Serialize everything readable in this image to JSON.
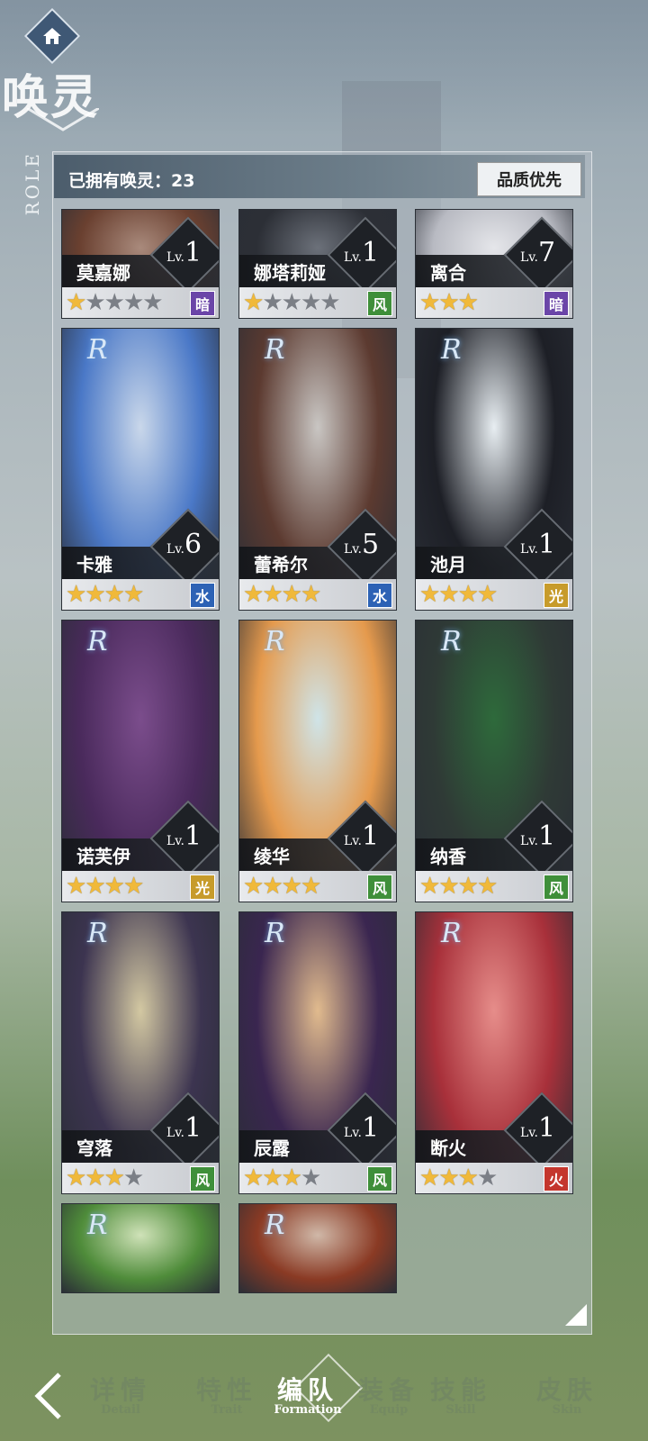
{
  "header": {
    "title": "唤灵",
    "role_label": "ROLE",
    "owned_text": "已拥有唤灵：23",
    "sort_label": "品质优先"
  },
  "cards": [
    {
      "name": "莫嘉娜",
      "level": "1",
      "stars": 1,
      "max_stars": 5,
      "element": "暗",
      "element_class": "e-dark",
      "colors": [
        "#6a4030",
        "#a98a7c"
      ]
    },
    {
      "name": "娜塔莉娅",
      "level": "1",
      "stars": 1,
      "max_stars": 5,
      "element": "风",
      "element_class": "e-wind",
      "colors": [
        "#2c2f36",
        "#6c717a"
      ]
    },
    {
      "name": "离合",
      "level": "7",
      "stars": 3,
      "max_stars": 3,
      "element": "暗",
      "element_class": "e-dark",
      "colors": [
        "#b8bac2",
        "#e5e6ea"
      ]
    },
    {
      "name": "卡雅",
      "level": "6",
      "rank": "R",
      "stars": 4,
      "max_stars": 4,
      "element": "水",
      "element_class": "e-water",
      "colors": [
        "#4a78c7",
        "#c9d7ea"
      ]
    },
    {
      "name": "蕾希尔",
      "level": "5",
      "rank": "R",
      "stars": 4,
      "max_stars": 4,
      "element": "水",
      "element_class": "e-water",
      "colors": [
        "#5c3a30",
        "#c9c6c3"
      ]
    },
    {
      "name": "池月",
      "level": "1",
      "rank": "R",
      "stars": 4,
      "max_stars": 4,
      "element": "光",
      "element_class": "e-light",
      "colors": [
        "#1d1f26",
        "#e8eef2"
      ]
    },
    {
      "name": "诺芙伊",
      "level": "1",
      "rank": "R",
      "stars": 4,
      "max_stars": 4,
      "element": "光",
      "element_class": "e-light",
      "colors": [
        "#4a2a5c",
        "#7b4d8c"
      ]
    },
    {
      "name": "绫华",
      "level": "1",
      "rank": "R",
      "stars": 4,
      "max_stars": 4,
      "element": "风",
      "element_class": "e-wind",
      "colors": [
        "#e59a4d",
        "#cfe4e8"
      ]
    },
    {
      "name": "纳香",
      "level": "1",
      "rank": "R",
      "stars": 4,
      "max_stars": 4,
      "element": "风",
      "element_class": "e-wind",
      "colors": [
        "#2f3a36",
        "#2e6a3b"
      ]
    },
    {
      "name": "穹落",
      "level": "1",
      "rank": "R",
      "stars": 3,
      "max_stars": 4,
      "element": "风",
      "element_class": "e-wind",
      "colors": [
        "#3c3450",
        "#d3c8a2"
      ]
    },
    {
      "name": "辰露",
      "level": "1",
      "rank": "R",
      "stars": 3,
      "max_stars": 4,
      "element": "风",
      "element_class": "e-wind",
      "colors": [
        "#3a2650",
        "#e1bb8e"
      ]
    },
    {
      "name": "断火",
      "level": "1",
      "rank": "R",
      "stars": 3,
      "max_stars": 4,
      "element": "火",
      "element_class": "e-fire",
      "colors": [
        "#a8303a",
        "#e68d8a"
      ]
    },
    {
      "name": "",
      "level": "",
      "rank": "R",
      "stars": 0,
      "max_stars": 0,
      "element": "",
      "element_class": "",
      "colors": [
        "#4f8c3a",
        "#cfe2b8"
      ]
    },
    {
      "name": "",
      "level": "",
      "rank": "R",
      "stars": 0,
      "max_stars": 0,
      "element": "",
      "element_class": "",
      "colors": [
        "#8a3a24",
        "#d0b8a8"
      ]
    }
  ],
  "level_prefix": "Lv.",
  "nav": {
    "tabs": [
      {
        "cn": "详情",
        "en": "Detail"
      },
      {
        "cn": "特性",
        "en": "Trait"
      },
      {
        "cn": "编队",
        "en": "Formation"
      },
      {
        "cn": "装备",
        "en": "Equip"
      },
      {
        "cn": "技能",
        "en": "Skill"
      },
      {
        "cn": "皮肤",
        "en": "Skin"
      }
    ],
    "active": "编队"
  }
}
